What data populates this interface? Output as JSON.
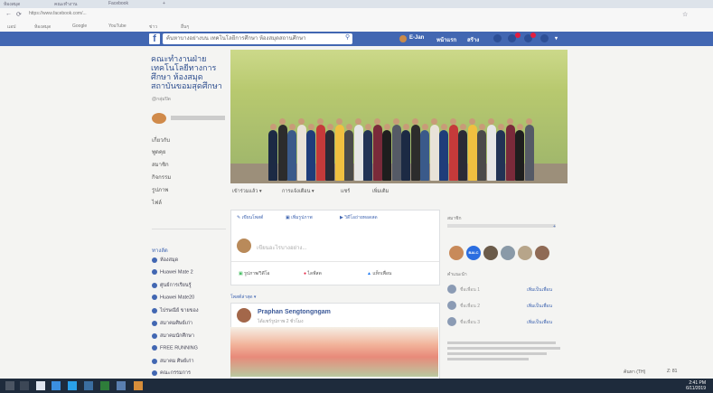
{
  "browser": {
    "tabs": [
      "ห้องสมุด",
      "คณะทำงาน",
      "Facebook",
      "+"
    ],
    "address": "https://www.facebook.com/...",
    "bookmarks": [
      "แอป",
      "ห้องสมุด",
      "Google",
      "YouTube",
      "ข่าว",
      "อื่นๆ"
    ]
  },
  "fb": {
    "search_placeholder": "ค้นหาบางอย่างบน เทคโนโลยีการศึกษา ห้องสมุดสถานศึกษา",
    "nav_name": "E-Jan",
    "nav_home": "หน้าแรก",
    "nav_create": "สร้าง",
    "brand_color": "#4267b2"
  },
  "left": {
    "title": "คณะทำงานฝ่าย เทคโนโลยีทางการศึกษา ห้องสมุด สถาบันขอมสุดศึกษา",
    "subtitle": "@กลุ่มปิด",
    "items": [
      "เกี่ยวกับ",
      "พูดคุย",
      "สมาชิก",
      "กิจกรรม",
      "รูปภาพ",
      "ไฟล์"
    ],
    "groups_header": "ทางลัด",
    "groups": [
      "ห้องสมุด",
      "Huawei Mate 2",
      "ศูนย์การเรียนรู้",
      "Huawei Mate20",
      "ไปรษณีย์ ขายของ",
      "สมาคมศิษย์เก่า",
      "สมาคมนักศึกษา",
      "FREE RUNNING",
      "สมาคม ศิษย์เก่า",
      "คณะกรรมการ"
    ]
  },
  "page_tabs": [
    "เข้าร่วมแล้ว ▾",
    "การแจ้งเตือน ▾",
    "แชร์",
    "เพิ่มเติม"
  ],
  "composer": {
    "placeholder": "เขียนอะไรบางอย่าง...",
    "actions": [
      "รูปภาพ/วิดีโอ",
      "ไลฟ์สด",
      "แท็กเพื่อน"
    ]
  },
  "post": {
    "author": "Praphan Sengtongngam",
    "meta": "ได้แชร์รูปภาพ 2 ชั่วโมง"
  },
  "right": {
    "members_header": "สมาชิก",
    "suggest_header": "คำแนะนำ",
    "friends": [
      "ชื่อเพื่อน 1",
      "ชื่อเพื่อน 2",
      "ชื่อเพื่อน 3"
    ],
    "add_friend": "เพิ่มเป็นเพื่อน"
  },
  "taskbar": {
    "time": "2:41 PM",
    "date": "6/11/2019",
    "search": "ค้นหา (TH)",
    "zoom": "Z:  81"
  }
}
